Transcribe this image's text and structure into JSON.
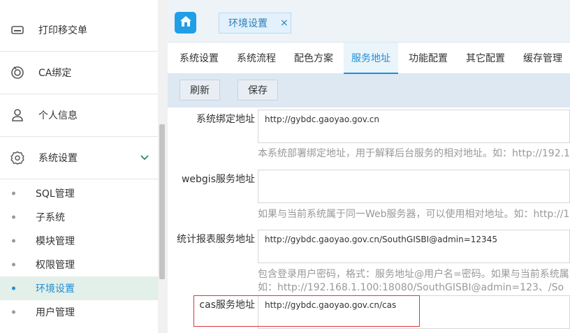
{
  "sidebar": {
    "items": [
      {
        "label": "打印移交单",
        "icon": "printer-icon"
      },
      {
        "label": "CA绑定",
        "icon": "ca-badge-icon"
      },
      {
        "label": "个人信息",
        "icon": "user-icon"
      },
      {
        "label": "系统设置",
        "icon": "gear-icon"
      }
    ],
    "sub_items": [
      {
        "label": "SQL管理"
      },
      {
        "label": "子系统"
      },
      {
        "label": "模块管理"
      },
      {
        "label": "权限管理"
      },
      {
        "label": "环境设置",
        "active": true
      },
      {
        "label": "用户管理"
      }
    ]
  },
  "tabbar": {
    "home_icon": "home-icon",
    "open_tab": {
      "label": "环境设置",
      "close": "×"
    }
  },
  "main_tabs": [
    {
      "label": "系统设置"
    },
    {
      "label": "系统流程"
    },
    {
      "label": "配色方案"
    },
    {
      "label": "服务地址",
      "active": true
    },
    {
      "label": "功能配置"
    },
    {
      "label": "其它配置"
    },
    {
      "label": "缓存管理"
    }
  ],
  "toolbar": {
    "refresh_label": "刷新",
    "save_label": "保存"
  },
  "form": {
    "fields": [
      {
        "label": "系统绑定地址",
        "value": "http://gybdc.gaoyao.gov.cn",
        "hint": "本系统部署绑定地址，用于解释后台服务的相对地址。如：http://192.1"
      },
      {
        "label": "webgis服务地址",
        "value": "",
        "hint": "如果与当前系统属于同一Web服务器，可以使用相对地址。如：http://1"
      },
      {
        "label": "统计报表服务地址",
        "value": "http://gybdc.gaoyao.gov.cn/SouthGISBI@admin=12345",
        "hint": "包含登录用户密码，格式：服务地址@用户名=密码。如果与当前系统属",
        "hint2": "如：http://192.168.1.100:18080/SouthGISBI@admin=123、/So"
      },
      {
        "label": "cas服务地址",
        "value": "http://gybdc.gaoyao.gov.cn/cas"
      }
    ]
  },
  "colors": {
    "accent": "#1e8fd6",
    "highlight_border": "#d9363e",
    "toolbar_bg": "#dde8f3"
  }
}
